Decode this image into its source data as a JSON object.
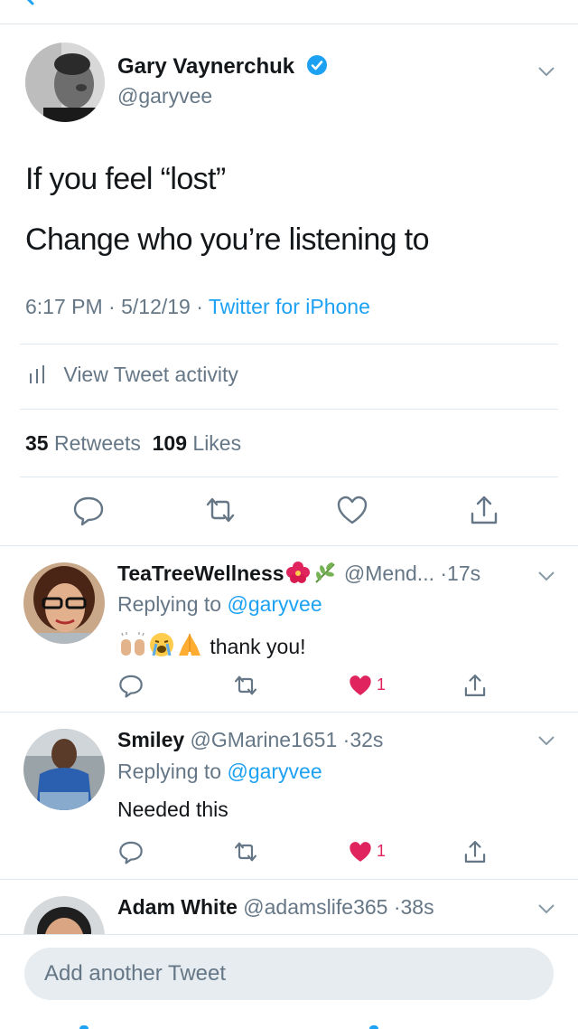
{
  "tweet": {
    "author_name": "Gary Vaynerchuk",
    "author_handle": "@garyvee",
    "text_line1": "If you feel “lost”",
    "text_line2": "Change who you’re listening to",
    "time": "6:17 PM",
    "date": "5/12/19",
    "source": "Twitter for iPhone",
    "activity_label": "View Tweet activity",
    "retweets_count": "35",
    "retweets_label": "Retweets",
    "likes_count": "109",
    "likes_label": "Likes",
    "sep": "·"
  },
  "replies": [
    {
      "name": "TeaTreeWellness",
      "name_emojis": [
        "hibiscus-icon",
        "herb-icon"
      ],
      "handle": "@Mend...",
      "time": "17s",
      "replying_prefix": "Replying to",
      "replying_to": "@garyvee",
      "text_emojis": [
        "raised-hands-icon",
        "crying-face-icon",
        "folded-hands-icon"
      ],
      "text": "thank you!",
      "likes": "1"
    },
    {
      "name": "Smiley",
      "handle": "@GMarine1651",
      "time": "32s",
      "replying_prefix": "Replying to",
      "replying_to": "@garyvee",
      "text": "Needed this",
      "likes": "1"
    },
    {
      "name": "Adam White",
      "handle": "@adamslife365",
      "time": "38s"
    }
  ],
  "compose": {
    "placeholder": "Add another Tweet"
  },
  "colors": {
    "accent": "#1da1f2",
    "like": "#e0245e",
    "secondary_text": "#657786",
    "divider": "#e1e8ed"
  }
}
